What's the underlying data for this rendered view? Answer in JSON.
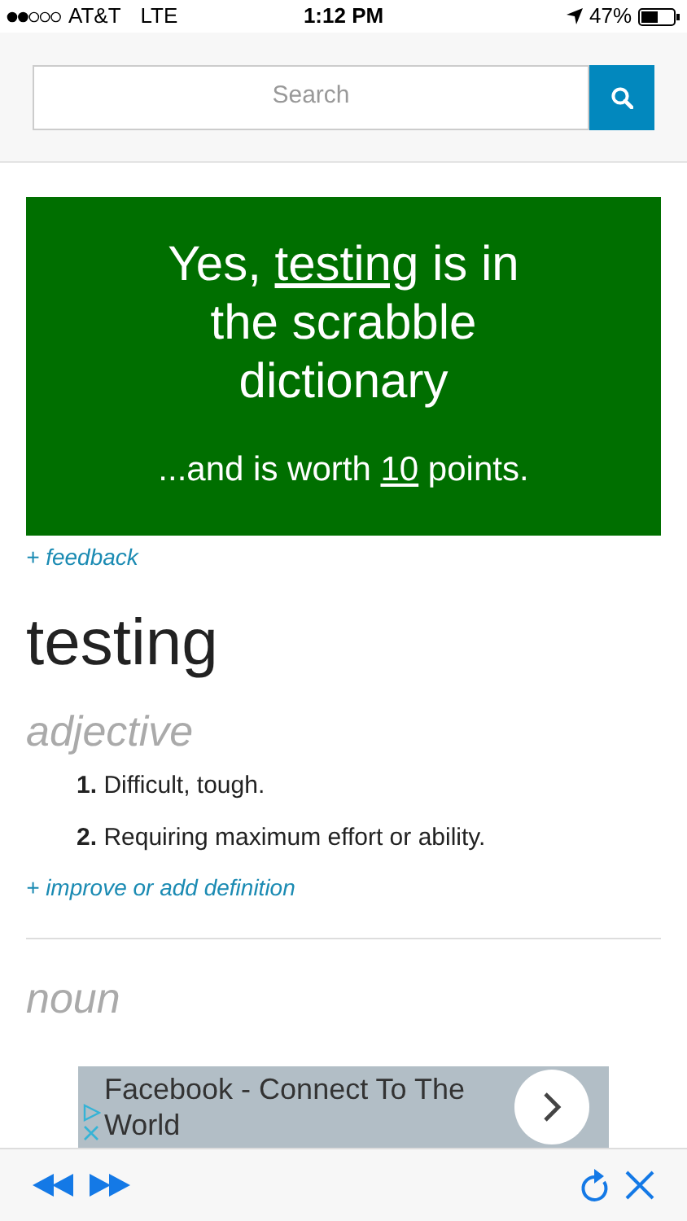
{
  "status_bar": {
    "carrier": "AT&T",
    "network": "LTE",
    "time": "1:12 PM",
    "battery": "47%"
  },
  "search": {
    "placeholder": "Search"
  },
  "result": {
    "prefix": "Yes, ",
    "word": "testing",
    "suffix": " is in the scrabble dictionary",
    "worth_prefix": "...and is worth ",
    "points": "10",
    "worth_suffix": " points."
  },
  "feedback_link": "+ feedback",
  "headword": "testing",
  "sections": [
    {
      "part_of_speech": "adjective",
      "definitions": [
        {
          "number": "1.",
          "text": "Difficult, tough."
        },
        {
          "number": "2.",
          "text": "Requiring maximum effort or ability."
        }
      ],
      "link": "+ improve or add definition"
    },
    {
      "part_of_speech": "noun"
    }
  ],
  "ad": {
    "text": "Facebook - Connect To The World"
  }
}
